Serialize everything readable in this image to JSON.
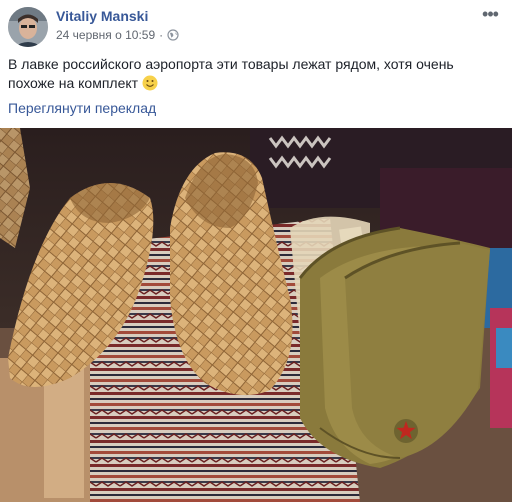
{
  "post": {
    "author": "Vitaliy Manski",
    "timestamp": "24 червня о 10:59",
    "separator": "·",
    "privacy_icon": "globe-icon",
    "more_icon": "more-options-icon",
    "more_glyph": "•••",
    "text": "В лавке российского аэропорта эти товары лежат рядом, хотя очень похоже на комплект",
    "emoji_icon": "smiley-icon",
    "translate_link": "Переглянути переклад"
  },
  "photo": {
    "subject": "photo"
  },
  "colors": {
    "link": "#385898",
    "text": "#1d2129",
    "meta": "#616770",
    "bark": "#c99a5f",
    "cap": "#8a7a3c",
    "star": "#c0271f"
  }
}
